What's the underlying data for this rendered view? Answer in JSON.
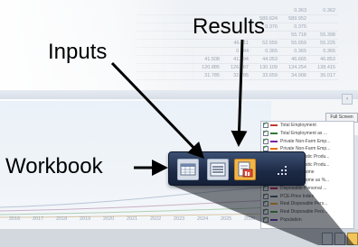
{
  "annotations": {
    "results": "Results",
    "inputs": "Inputs",
    "workbook": "Workbook"
  },
  "spreadsheet": {
    "rows": [
      [
        "",
        "",
        "",
        "",
        "",
        "0.363",
        "0.362"
      ],
      [
        "",
        "",
        "",
        "",
        "589.624",
        "589.952",
        ""
      ],
      [
        "",
        "",
        "",
        "",
        "0.376",
        "0.375",
        ""
      ],
      [
        "",
        "",
        "",
        "",
        "",
        "55.718",
        "55.398"
      ],
      [
        "",
        "",
        "",
        "46.311",
        "52.555",
        "55.659",
        "55.225"
      ],
      [
        "",
        "",
        "",
        "0.384",
        "0.365",
        "0.365",
        "0.365"
      ],
      [
        "",
        "",
        "41.508",
        "41.494",
        "44.053",
        "46.665",
        "46.853"
      ],
      [
        "",
        "",
        "120.885",
        "126.267",
        "130.109",
        "134.254",
        "138.415"
      ],
      [
        "",
        "",
        "31.785",
        "32.785",
        "33.659",
        "34.908",
        "36.017"
      ]
    ]
  },
  "chart": {
    "x_labels": [
      "2016",
      "2017",
      "2018",
      "2019",
      "2020",
      "2021",
      "2022",
      "2023",
      "2024",
      "2025",
      "2026"
    ],
    "legend_button": "Full Screen",
    "legend_items": [
      {
        "label": "Total Employment",
        "color": "#c0392b"
      },
      {
        "label": "Total Employment as ...",
        "color": "#2e7d32"
      },
      {
        "label": "Private Non-Farm Emp...",
        "color": "#7b1fa2"
      },
      {
        "label": "Private Non-Farm Emp...",
        "color": "#ef6c00"
      },
      {
        "label": "Gross Domestic Produ...",
        "color": "#1565c0"
      },
      {
        "label": "Gross Domestic Produ...",
        "color": "#00897b"
      },
      {
        "label": "Personal Income",
        "color": "#6d4c41"
      },
      {
        "label": "Personal Income as %...",
        "color": "#9e9d24"
      },
      {
        "label": "Disposable Personal ...",
        "color": "#d81b60"
      },
      {
        "label": "PCE-Price Index",
        "color": "#455a64"
      },
      {
        "label": "Real Disposable Pers...",
        "color": "#f9a825"
      },
      {
        "label": "Real Disposable Pers...",
        "color": "#43a047"
      },
      {
        "label": "Population",
        "color": "#5e35b1"
      }
    ]
  },
  "toolbar": {
    "buttons": [
      {
        "name": "workbook",
        "icon": "workbook-icon"
      },
      {
        "name": "inputs",
        "icon": "inputs-icon"
      },
      {
        "name": "results",
        "icon": "results-icon"
      },
      {
        "name": "more",
        "icon": "more-options-icon"
      }
    ]
  },
  "colors": {
    "toolbar_bg": "#1d2a45",
    "results_active": "#f3b545"
  }
}
